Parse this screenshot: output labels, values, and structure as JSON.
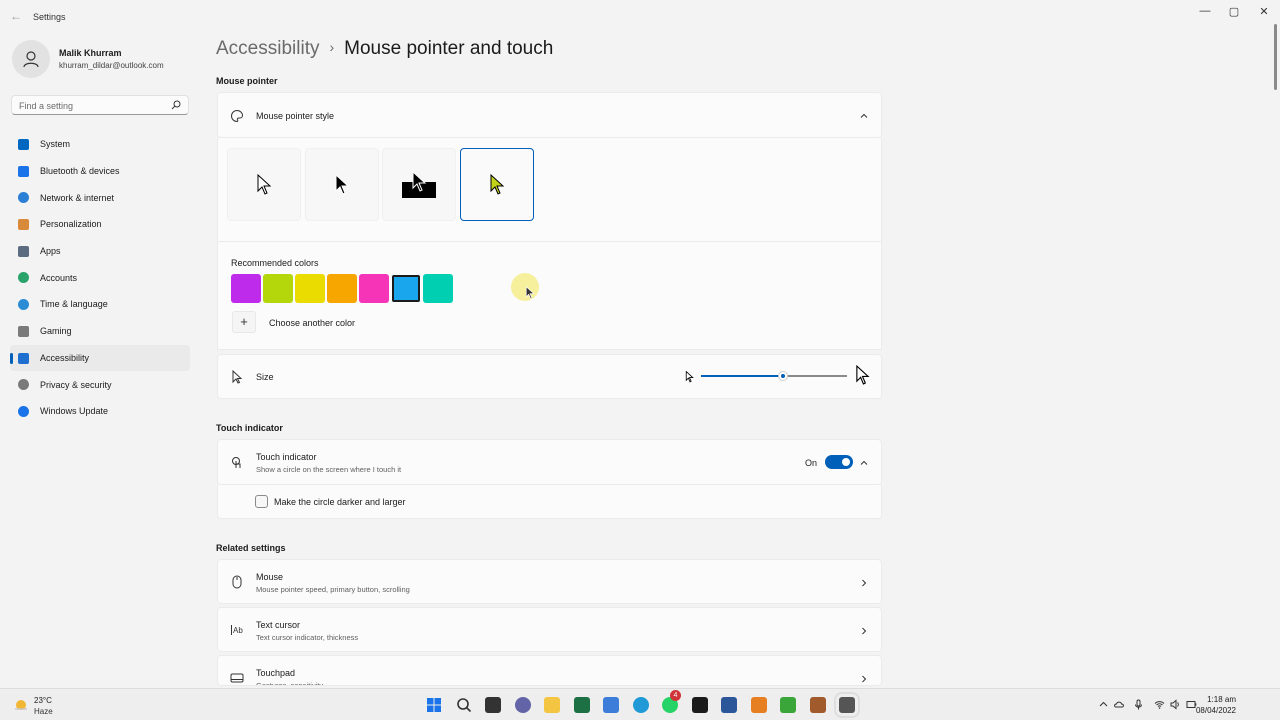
{
  "window": {
    "title": "Settings",
    "back": "←",
    "min": "—",
    "max": "▢",
    "close": "✕"
  },
  "profile": {
    "name": "Malik Khurram",
    "email": "khurram_dildar@outlook.com"
  },
  "search": {
    "placeholder": "Find a setting"
  },
  "nav": [
    {
      "label": "System",
      "icon": "monitor-icon",
      "color": "#0067c0"
    },
    {
      "label": "Bluetooth & devices",
      "icon": "bluetooth-icon",
      "color": "#1a73e8"
    },
    {
      "label": "Network & internet",
      "icon": "wifi-icon",
      "color": "#2b7fd4"
    },
    {
      "label": "Personalization",
      "icon": "brush-icon",
      "color": "#d8893a"
    },
    {
      "label": "Apps",
      "icon": "apps-icon",
      "color": "#5b6c80"
    },
    {
      "label": "Accounts",
      "icon": "person-icon",
      "color": "#2aa36b"
    },
    {
      "label": "Time & language",
      "icon": "globe-clock-icon",
      "color": "#2a8cd4"
    },
    {
      "label": "Gaming",
      "icon": "gamepad-icon",
      "color": "#7a7a7a"
    },
    {
      "label": "Accessibility",
      "icon": "accessibility-icon",
      "color": "#1f6fd1",
      "active": true
    },
    {
      "label": "Privacy & security",
      "icon": "shield-icon",
      "color": "#7a7a7a"
    },
    {
      "label": "Windows Update",
      "icon": "update-icon",
      "color": "#1a73e8"
    }
  ],
  "breadcrumb": {
    "parent": "Accessibility",
    "separator": "›",
    "current": "Mouse pointer and touch"
  },
  "mouse_pointer": {
    "heading": "Mouse pointer",
    "style_title": "Mouse pointer style",
    "pointer_styles": [
      "white",
      "black",
      "inverted",
      "custom"
    ],
    "selected_style": "custom",
    "recommended_label": "Recommended colors",
    "colors": [
      "#bf2bea",
      "#b4d70c",
      "#ebdc00",
      "#f7a600",
      "#f534b8",
      "#19a6ec",
      "#00cfb1"
    ],
    "selected_color": "#19a6ec",
    "choose_plus": "+",
    "choose_label": "Choose another color",
    "size_label": "Size",
    "size_value": 0.56
  },
  "touch": {
    "heading": "Touch indicator",
    "title": "Touch indicator",
    "subtitle": "Show a circle on the screen where I touch it",
    "state": "On",
    "darker_label": "Make the circle darker and larger"
  },
  "related": {
    "heading": "Related settings",
    "items": [
      {
        "title": "Mouse",
        "subtitle": "Mouse pointer speed, primary button, scrolling",
        "icon": "mouse-icon"
      },
      {
        "title": "Text cursor",
        "subtitle": "Text cursor indicator, thickness",
        "icon": "text-cursor-icon"
      },
      {
        "title": "Touchpad",
        "subtitle": "Gestures, sensitivity",
        "icon": "touchpad-icon"
      }
    ]
  },
  "taskbar": {
    "weather_temp": "23°C",
    "weather_cond": "Haze",
    "time": "1:18 am",
    "date": "08/04/2022",
    "notification_badge": "4",
    "apps": [
      {
        "name": "start-icon",
        "color": "#1a73e8"
      },
      {
        "name": "search-icon",
        "color": "#333333"
      },
      {
        "name": "task-view-icon",
        "color": "#333333"
      },
      {
        "name": "chat-icon",
        "color": "#6264a7"
      },
      {
        "name": "file-explorer-icon",
        "color": "#f4c542"
      },
      {
        "name": "excel-icon",
        "color": "#1d7044"
      },
      {
        "name": "paint-icon",
        "color": "#3b7dd8"
      },
      {
        "name": "edge-icon",
        "color": "#1f9ad6"
      },
      {
        "name": "whatsapp-icon",
        "color": "#25d366"
      },
      {
        "name": "terminal-icon",
        "color": "#1b1b1b"
      },
      {
        "name": "word-icon",
        "color": "#2b579a"
      },
      {
        "name": "orange-app-icon",
        "color": "#e67e22"
      },
      {
        "name": "camtasia-icon",
        "color": "#3aa63a"
      },
      {
        "name": "chrome-canary-icon",
        "color": "#a05a2c"
      },
      {
        "name": "settings-icon",
        "color": "#555555"
      }
    ]
  }
}
